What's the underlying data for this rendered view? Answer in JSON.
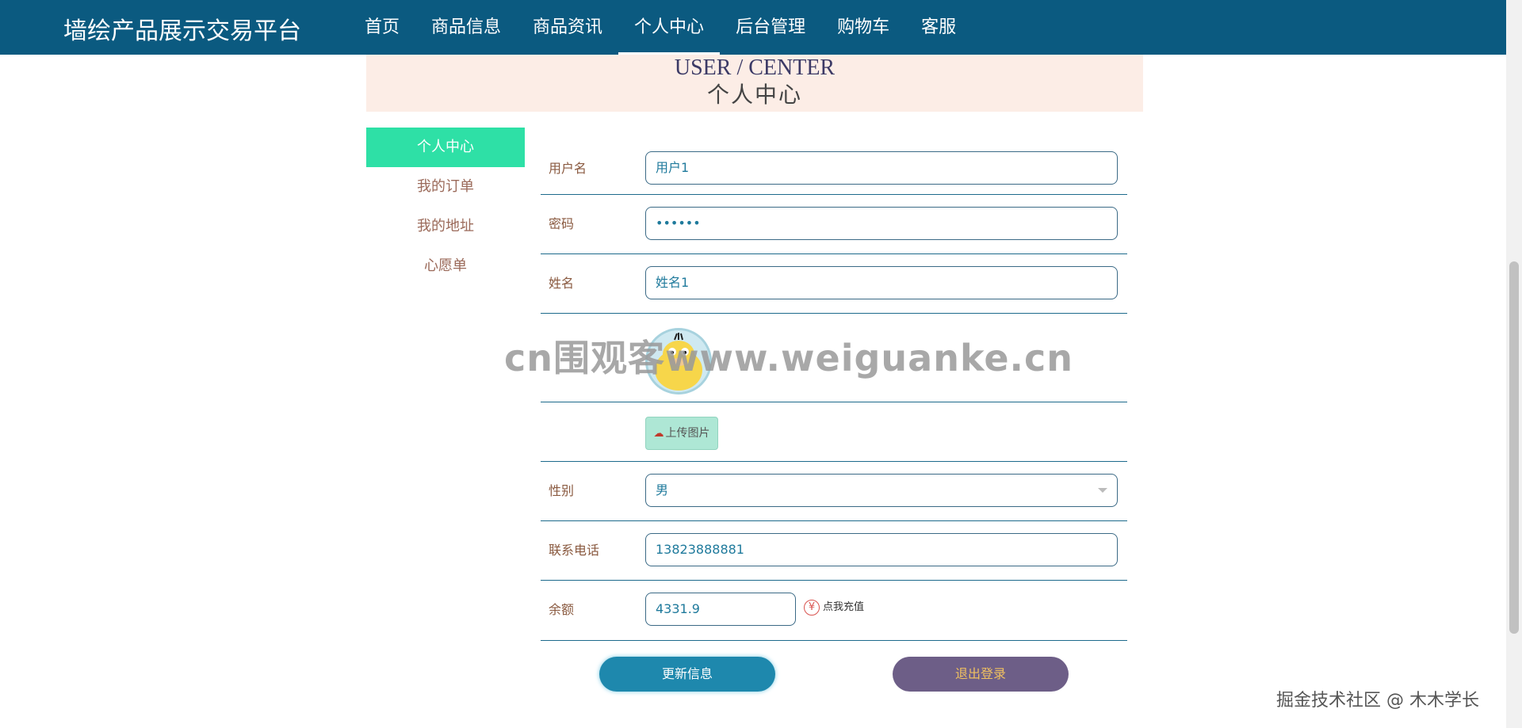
{
  "brand": "墙绘产品展示交易平台",
  "nav": [
    "首页",
    "商品信息",
    "商品资讯",
    "个人中心",
    "后台管理",
    "购物车",
    "客服"
  ],
  "nav_active_index": 3,
  "banner": {
    "en": "USER / CENTER",
    "cn": "个人中心"
  },
  "sidebar": [
    "个人中心",
    "我的订单",
    "我的地址",
    "心愿单"
  ],
  "form": {
    "username": {
      "label": "用户名",
      "value": "用户1"
    },
    "password": {
      "label": "密码",
      "value": "••••••"
    },
    "name": {
      "label": "姓名",
      "value": "姓名1"
    },
    "upload_label": "上传图片",
    "gender": {
      "label": "性别",
      "value": "男"
    },
    "phone": {
      "label": "联系电话",
      "value": "13823888881"
    },
    "balance": {
      "label": "余额",
      "value": "4331.9",
      "recharge": "点我充值",
      "currency_symbol": "¥"
    }
  },
  "buttons": {
    "update": "更新信息",
    "logout": "退出登录"
  },
  "watermark": "cn围观客www.weiguanke.cn",
  "footer_watermark": "掘金技术社区 @ 木木学长",
  "colors": {
    "nav_bg": "#0b5a80",
    "sidebar_active": "#2ee0a6",
    "banner_bg": "#fcede6",
    "update_btn": "#1e88ad",
    "logout_btn": "#6d5e87"
  },
  "icons": [
    "cloud-upload-icon",
    "yen-icon",
    "chevron-down-icon",
    "avatar-image"
  ]
}
